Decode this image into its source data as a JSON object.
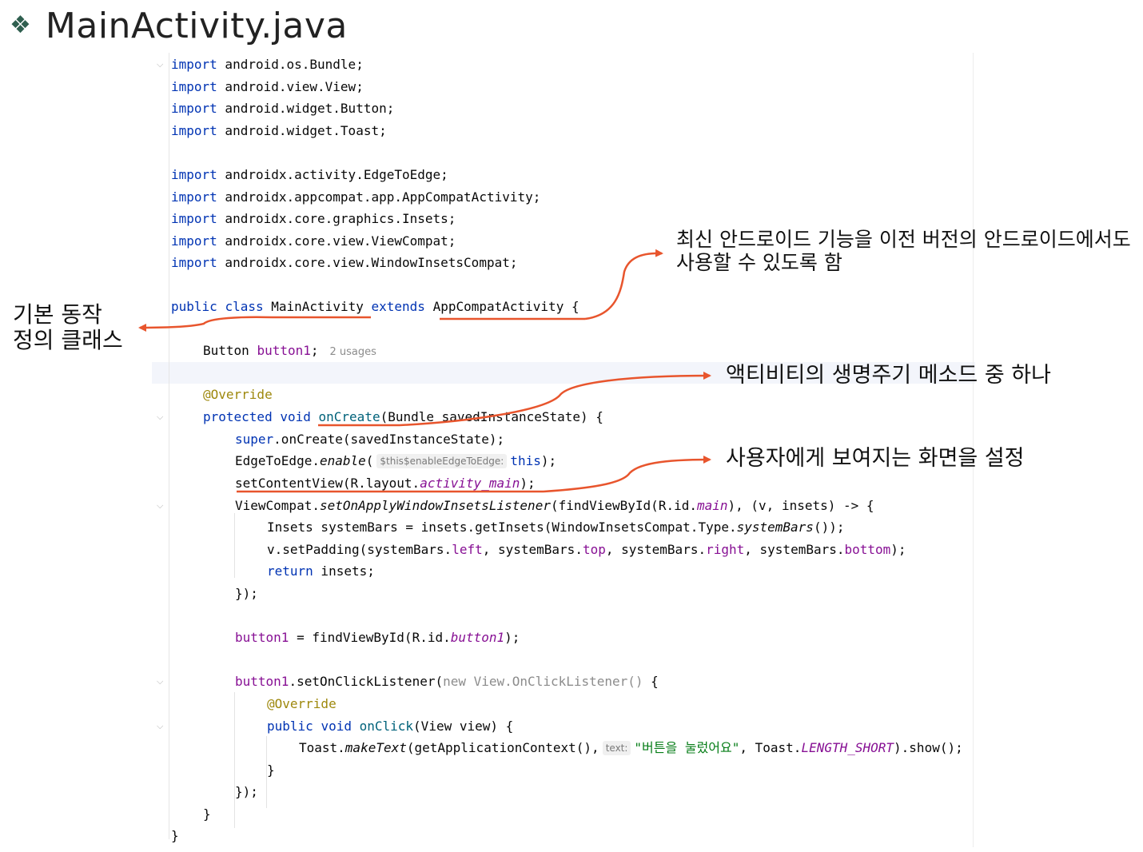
{
  "slide": {
    "title": "MainActivity.java"
  },
  "code": {
    "l1": {
      "kw": "import",
      "rest": " android.os.Bundle;"
    },
    "l2": {
      "kw": "import",
      "rest": " android.view.View;"
    },
    "l3": {
      "kw": "import",
      "rest": " android.widget.Button;"
    },
    "l4": {
      "kw": "import",
      "rest": " android.widget.Toast;"
    },
    "l5": {
      "kw": "import",
      "rest": " androidx.activity.EdgeToEdge;"
    },
    "l6": {
      "kw": "import",
      "rest": " androidx.appcompat.app.AppCompatActivity;"
    },
    "l7": {
      "kw": "import",
      "rest": " androidx.core.graphics.Insets;"
    },
    "l8": {
      "kw": "import",
      "rest": " androidx.core.view.ViewCompat;"
    },
    "l9": {
      "kw": "import",
      "rest": " androidx.core.view.WindowInsetsCompat;"
    },
    "cls": {
      "kw1": "public",
      "kw2": "class",
      "name": "MainActivity",
      "kw3": "extends",
      "parent": "AppCompatActivity",
      "tail": " {"
    },
    "field": {
      "type": "Button ",
      "name": "button1",
      "tail": ";",
      "usages": "2 usages"
    },
    "override1": "@Override",
    "oncreate": {
      "kw1": "protected",
      "kw2": "void",
      "name": "onCreate",
      "params": "(Bundle savedInstanceState) {"
    },
    "super": {
      "kw": "super",
      "rest": ".onCreate(savedInstanceState);"
    },
    "edge": {
      "pre": "EdgeToEdge.",
      "method": "enable",
      "open": "(",
      "hint": "$this$enableEdgeToEdge:",
      "kw": "this",
      "tail": ");"
    },
    "setcontent": {
      "pre": "setContentView(R.layout.",
      "res": "activity_main",
      "tail": ");"
    },
    "vc": {
      "pre": "ViewCompat.",
      "method": "setOnApplyWindowInsetsListener",
      "mid": "(findViewById(R.id.",
      "res": "main",
      "tail": "), (v, insets) -> {"
    },
    "insets": {
      "pre": "Insets systemBars = insets.getInsets(WindowInsetsCompat.Type.",
      "method": "systemBars",
      "tail": "());"
    },
    "padding": {
      "pre": "v.setPadding(systemBars.",
      "f1": "left",
      "s1": ", systemBars.",
      "f2": "top",
      "s2": ", systemBars.",
      "f3": "right",
      "s3": ", systemBars.",
      "f4": "bottom",
      "tail": ");"
    },
    "ret": {
      "kw": "return",
      "rest": " insets;"
    },
    "close1": "});",
    "find": {
      "var": "button1",
      "mid": " = findViewById(R.id.",
      "res": "button1",
      "tail": ");"
    },
    "click": {
      "var": "button1",
      "mid": ".setOnClickListener(",
      "anon": "new View.OnClickListener()",
      "tail": " {"
    },
    "override2": "@Override",
    "onclick": {
      "kw1": "public",
      "kw2": "void",
      "name": "onClick",
      "params": "(View view) {"
    },
    "toast": {
      "pre": "Toast.",
      "method": "makeText",
      "mid": "(getApplicationContext(),",
      "hint": "text:",
      "str": "\"버튼을 눌렀어요\"",
      "mid2": ", Toast.",
      "const": "LENGTH_SHORT",
      "tail": ").show();"
    },
    "brace1": "}",
    "close2": "});",
    "brace2": "}",
    "brace3": "}"
  },
  "notes": {
    "basic_line1": "기본 동작",
    "basic_line2": "정의 클래스",
    "compat_line1": "최신 안드로이드 기능을 이전 버전의 안드로이드에서도",
    "compat_line2": "사용할 수 있도록 함",
    "lifecycle": "액티비티의 생명주기 메소드 중 하나",
    "screen": "사용자에게 보여지는 화면을 설정"
  },
  "colors": {
    "accent": "#e8552d",
    "keyword": "#0033b3",
    "annotation": "#9e880d",
    "string": "#067d17",
    "field": "#871094"
  }
}
